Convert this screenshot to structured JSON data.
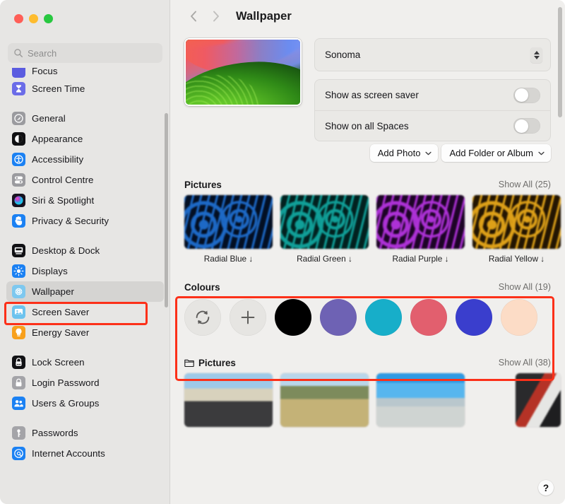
{
  "window": {
    "traffic_lights": [
      "close",
      "minimize",
      "zoom"
    ]
  },
  "search": {
    "placeholder": "Search",
    "value": "",
    "icon": "search-icon"
  },
  "sidebar": {
    "groups": [
      {
        "items": [
          {
            "label": "Focus",
            "icon": "focus-icon",
            "selected": false,
            "clipped": true
          },
          {
            "label": "Screen Time",
            "icon": "screen-time-icon",
            "selected": false
          }
        ]
      },
      {
        "items": [
          {
            "label": "General",
            "icon": "general-icon",
            "selected": false
          },
          {
            "label": "Appearance",
            "icon": "appearance-icon",
            "selected": false
          },
          {
            "label": "Accessibility",
            "icon": "accessibility-icon",
            "selected": false
          },
          {
            "label": "Control Centre",
            "icon": "control-centre-icon",
            "selected": false
          },
          {
            "label": "Siri & Spotlight",
            "icon": "siri-icon",
            "selected": false
          },
          {
            "label": "Privacy & Security",
            "icon": "privacy-icon",
            "selected": false
          }
        ]
      },
      {
        "items": [
          {
            "label": "Desktop & Dock",
            "icon": "desktop-dock-icon",
            "selected": false
          },
          {
            "label": "Displays",
            "icon": "displays-icon",
            "selected": false
          },
          {
            "label": "Wallpaper",
            "icon": "wallpaper-icon",
            "selected": true
          },
          {
            "label": "Screen Saver",
            "icon": "screen-saver-icon",
            "selected": false
          },
          {
            "label": "Energy Saver",
            "icon": "energy-saver-icon",
            "selected": false
          }
        ]
      },
      {
        "items": [
          {
            "label": "Lock Screen",
            "icon": "lock-screen-icon",
            "selected": false
          },
          {
            "label": "Login Password",
            "icon": "login-password-icon",
            "selected": false
          },
          {
            "label": "Users & Groups",
            "icon": "users-groups-icon",
            "selected": false
          }
        ]
      },
      {
        "items": [
          {
            "label": "Passwords",
            "icon": "passwords-icon",
            "selected": false
          },
          {
            "label": "Internet Accounts",
            "icon": "internet-accounts-icon",
            "selected": false
          }
        ]
      }
    ]
  },
  "header": {
    "back_icon": "chevron-left-icon",
    "forward_icon": "chevron-right-icon",
    "title": "Wallpaper"
  },
  "top": {
    "preview_name": "sonoma-wallpaper-preview",
    "popup": {
      "value": "Sonoma",
      "stepper_icon": "stepper-up-down-icon"
    },
    "toggles": [
      {
        "label": "Show as screen saver",
        "on": false
      },
      {
        "label": "Show on all Spaces",
        "on": false
      }
    ],
    "buttons": [
      {
        "label": "Add Photo",
        "icon": "chevron-down-icon"
      },
      {
        "label": "Add Folder or Album",
        "icon": "chevron-down-icon"
      }
    ]
  },
  "sections": [
    {
      "id": "pictures-radial",
      "title": "Pictures",
      "has_folder_icon": false,
      "show_all": "Show All (25)",
      "items": [
        {
          "label": "Radial Blue ↓",
          "color": "#1f6fd0",
          "dark": "#041024"
        },
        {
          "label": "Radial Green ↓",
          "color": "#11a7a0",
          "dark": "#032220"
        },
        {
          "label": "Radial Purple ↓",
          "color": "#b634e0",
          "dark": "#1e0526"
        },
        {
          "label": "Radial Yellow ↓",
          "color": "#e8a81a",
          "dark": "#241603"
        }
      ]
    }
  ],
  "colours": {
    "title": "Colours",
    "show_all": "Show All (19)",
    "buttons": [
      {
        "name": "shuffle-refresh-button",
        "icon": "refresh-icon"
      },
      {
        "name": "add-colour-button",
        "icon": "plus-icon"
      }
    ],
    "swatches": [
      {
        "name": "colour-black",
        "hex": "#000000"
      },
      {
        "name": "colour-purple",
        "hex": "#6e62b4"
      },
      {
        "name": "colour-cyan",
        "hex": "#17aec9"
      },
      {
        "name": "colour-pink-red",
        "hex": "#e25f6e"
      },
      {
        "name": "colour-blue",
        "hex": "#3a3ecd"
      },
      {
        "name": "colour-peach",
        "hex": "#fcdcc6"
      }
    ],
    "highlighted": true
  },
  "photos_section": {
    "title": "Pictures",
    "has_folder_icon": true,
    "show_all": "Show All (38)",
    "items": [
      {
        "name": "photo-thumbnail-1"
      },
      {
        "name": "photo-thumbnail-2"
      },
      {
        "name": "photo-thumbnail-3"
      },
      {
        "name": "photo-thumbnail-4"
      }
    ]
  },
  "help": {
    "label": "?"
  },
  "accents": {
    "highlight_box": "#fc3019",
    "sidebar_bg": "#e7e6e4",
    "main_bg": "#f0efed",
    "selected_row": "#d5d4d2"
  }
}
